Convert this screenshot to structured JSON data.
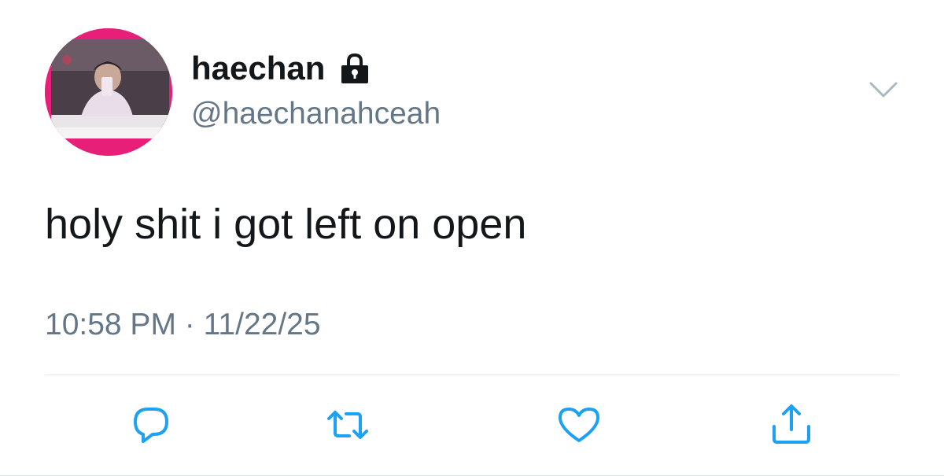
{
  "user": {
    "display_name": "haechan",
    "handle": "@haechanahceah",
    "avatar_icon": "user-avatar",
    "protected_icon": "lock-icon"
  },
  "tweet": {
    "text": "holy shit i got left on open",
    "time": "10:58 PM",
    "separator": "·",
    "date": "11/22/25"
  },
  "actions": [
    {
      "name": "reply",
      "icon": "reply-icon"
    },
    {
      "name": "retweet",
      "icon": "retweet-icon"
    },
    {
      "name": "like",
      "icon": "heart-icon"
    },
    {
      "name": "share",
      "icon": "share-icon"
    }
  ],
  "colors": {
    "text_primary": "#14171a",
    "text_secondary": "#657786",
    "accent_blue": "#1da1f2",
    "avatar_border": "#e81f78",
    "divider": "#e1e8ed"
  }
}
